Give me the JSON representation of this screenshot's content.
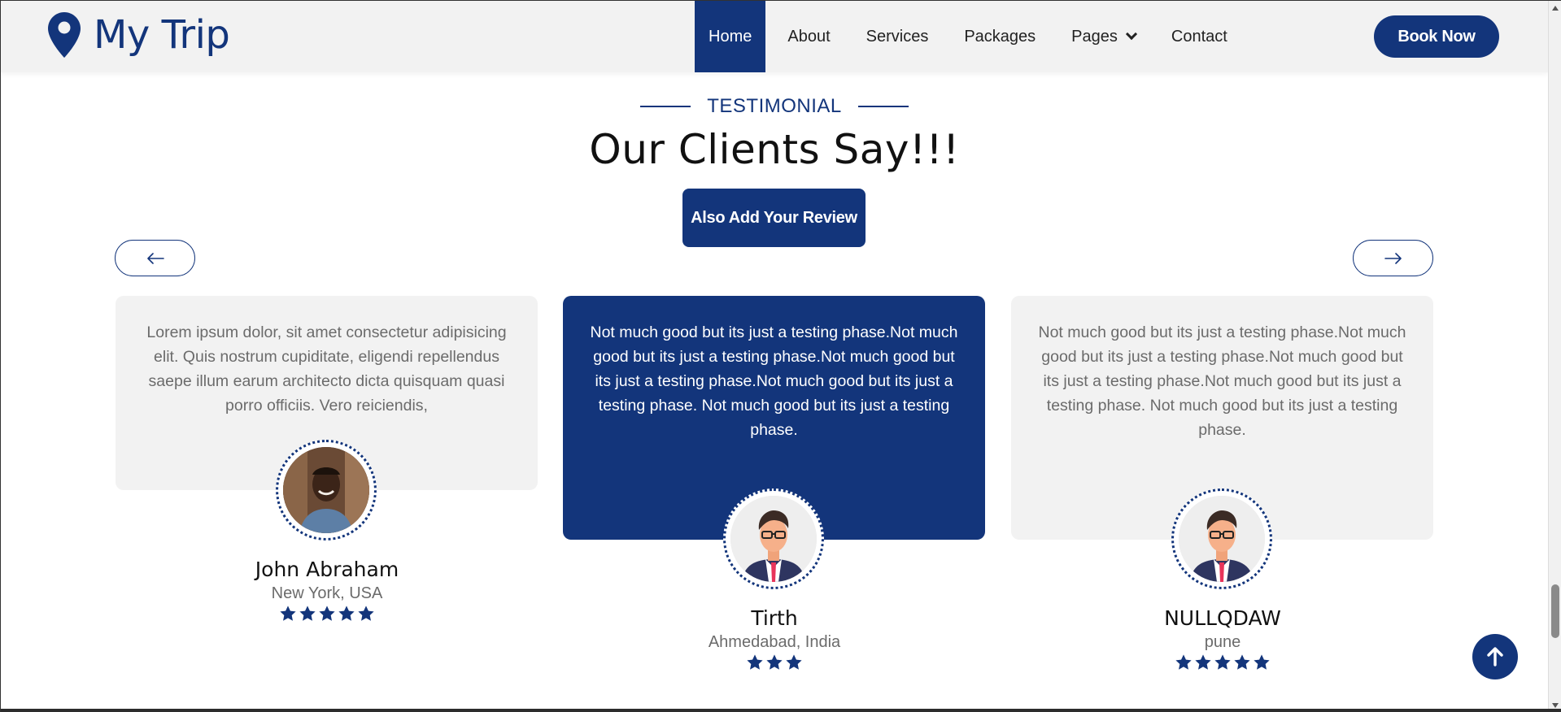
{
  "brand": {
    "name": "My Trip",
    "icon": "map-pin-icon"
  },
  "nav": {
    "items": [
      {
        "label": "Home",
        "active": true
      },
      {
        "label": "About"
      },
      {
        "label": "Services"
      },
      {
        "label": "Packages"
      },
      {
        "label": "Pages",
        "dropdown": true
      },
      {
        "label": "Contact"
      }
    ],
    "cta": "Book Now"
  },
  "section": {
    "eyebrow": "TESTIMONIAL",
    "title": "Our Clients Say!!!",
    "review_button": "Also Add Your Review"
  },
  "carousel": {
    "prev_icon": "arrow-left-icon",
    "next_icon": "arrow-right-icon"
  },
  "testimonials": [
    {
      "text": "Lorem ipsum dolor, sit amet consectetur adipisicing elit. Quis nostrum cupiditate, eligendi repellendus saepe illum earum architecto dicta quisquam quasi porro officiis. Vero reiciendis,",
      "name": "John Abraham",
      "location": "New York, USA",
      "rating": 5
    },
    {
      "text": "Not much good but its just a testing phase.Not much good but its just a testing phase.Not much good but its just a testing phase.Not much good but its just a testing phase. Not much good but its just a testing phase.",
      "name": "Tirth",
      "location": "Ahmedabad, India",
      "rating": 3
    },
    {
      "text": "Not much good but its just a testing phase.Not much good but its just a testing phase.Not much good but its just a testing phase.Not much good but its just a testing phase. Not much good but its just a testing phase.",
      "name": "NULLQDAW",
      "location": "pune",
      "rating": 5
    }
  ],
  "colors": {
    "primary": "#13357b",
    "card_bg": "#f2f2f2",
    "text_muted": "#6b6b6b"
  }
}
